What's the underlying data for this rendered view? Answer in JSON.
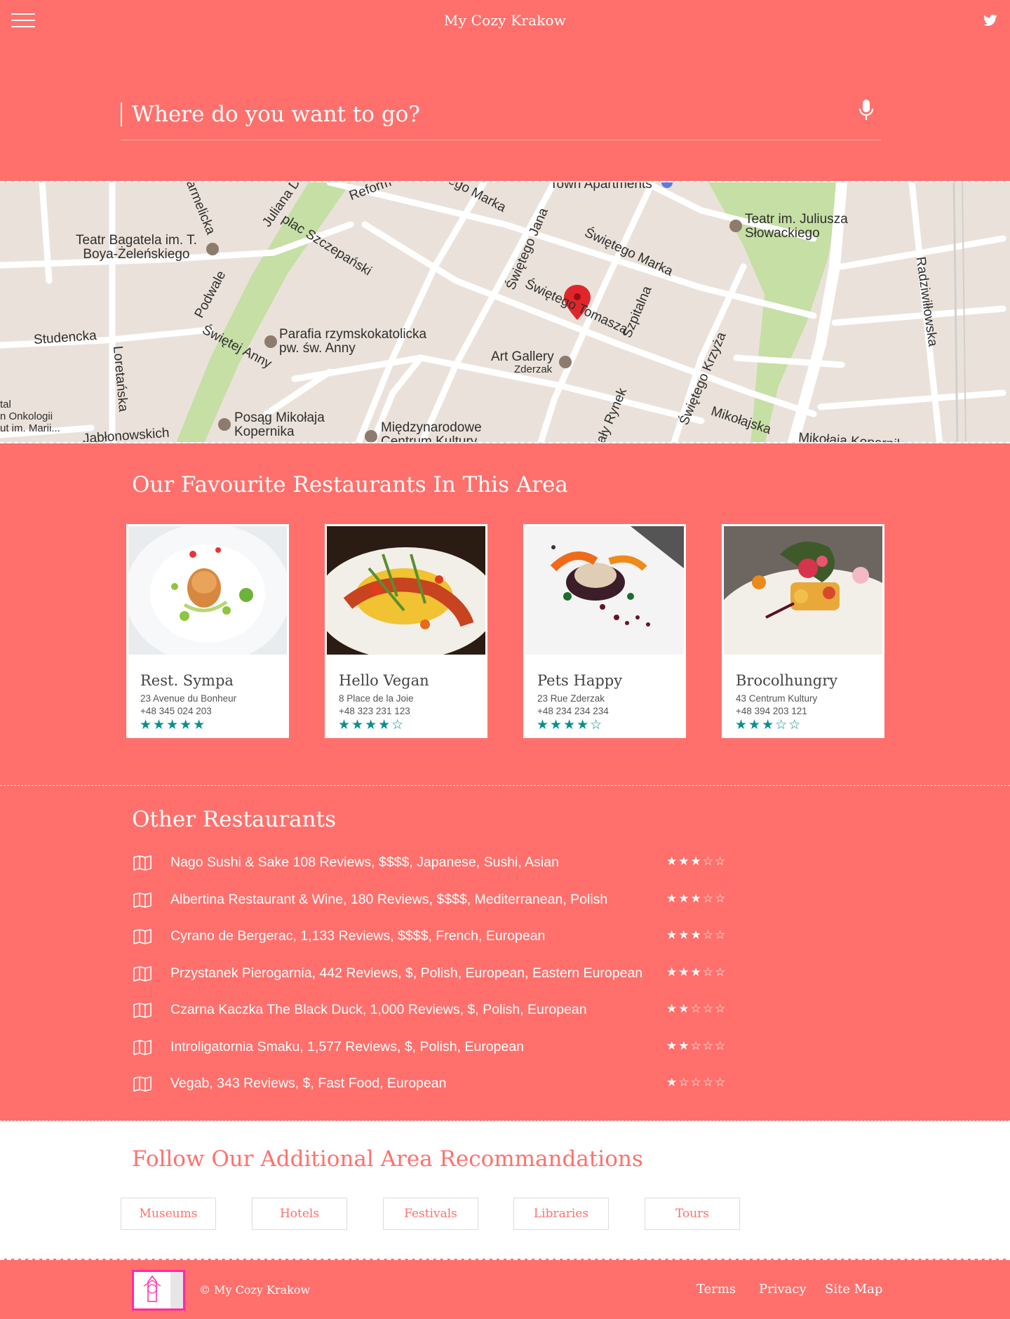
{
  "header": {
    "title": "My Cozy Krakow",
    "menu_icon": "hamburger-icon",
    "social_icon": "twitter-icon"
  },
  "search": {
    "placeholder": "Where do you want to go?",
    "value": "",
    "mic_icon": "microphone-icon"
  },
  "map": {
    "labels": {
      "teatr_bagatela": "Teatr Bagatela im. T.\nBoya-Żeleńskiego",
      "teatr_slowackiego": "Teatr im. Juliusza\nSłowackiego",
      "parafia": "Parafia rzymskokatolicka\npw. św. Anny",
      "art_gallery": "Art Gallery",
      "zderzak": "Zderzak",
      "posag": "Posąg Mikołaja\nKopernika",
      "miedzynarodowe": "Międzynarodowe\nCentrum Kultury",
      "town_apartments": "Town Apartments",
      "onkologii": "tal\nn Onkologii\nut im. Marii...",
      "studencka": "Studencka",
      "loretanska": "Loretańska",
      "podwale": "Podwale",
      "swietej_anny": "Świętej Anny",
      "plac_szczepanski": "plac Szczepański",
      "swietego_jana": "Świętego Jana",
      "swietego_marka": "Świętego Marka",
      "swietego_marka_2": "ego Marka",
      "swietego_tomasza": "Świętego Tomasza",
      "szpitalna": "Szpitalna",
      "swietego_krzyza": "Świętego Krzyża",
      "mikolajska": "Mikołajska",
      "mikolaja_kopernika": "Mikołaja Kopernika",
      "radziwillowska": "Radziwiłłowska",
      "karmelicka": "Karmelicka",
      "juliana_dunajewskiego": "Juliana Du",
      "reform": "Reform",
      "jablonowskich": "Jabłonowskich",
      "maly_rynek": "Mały Rynek"
    },
    "marker_icon": "location-pin-icon"
  },
  "favourites": {
    "title": "Our Favourite Restaurants In This Area",
    "cards": [
      {
        "name": "Rest. Sympa",
        "address": "23 Avenue du Bonheur",
        "phone": "+48 345 024 203",
        "rating": 5,
        "stars": "★★★★★"
      },
      {
        "name": "Hello Vegan",
        "address": "8 Place de la Joie",
        "phone": "+48 323 231 123",
        "rating": 4,
        "stars": "★★★★☆"
      },
      {
        "name": "Pets Happy",
        "address": "23 Rue Zderzak",
        "phone": "+48 234 234 234",
        "rating": 4,
        "stars": "★★★★☆"
      },
      {
        "name": "Brocolhungry",
        "address": "43 Centrum Kultury",
        "phone": "+48 394 203 121",
        "rating": 3,
        "stars": "★★★☆☆"
      }
    ]
  },
  "others": {
    "title": "Other Restaurants",
    "icon": "book-map-icon",
    "items": [
      {
        "label": "Nago Sushi & Sake 108 Reviews, $$$$, Japanese, Sushi, Asian",
        "rating": 3,
        "stars": "★★★☆☆"
      },
      {
        "label": "Albertina Restaurant & Wine, 180 Reviews, $$$$, Mediterranean, Polish",
        "rating": 3,
        "stars": "★★★☆☆"
      },
      {
        "label": "Cyrano de Bergerac, 1,133 Reviews, $$$$, French, European",
        "rating": 3,
        "stars": "★★★☆☆"
      },
      {
        "label": "Przystanek Pierogarnia, 442 Reviews, $, Polish, European, Eastern European",
        "rating": 3,
        "stars": "★★★☆☆"
      },
      {
        "label": "Czarna Kaczka The Black Duck, 1,000 Reviews, $, Polish, European",
        "rating": 2,
        "stars": "★★☆☆☆"
      },
      {
        "label": "Introligatornia Smaku, 1,577 Reviews, $, Polish, European",
        "rating": 2,
        "stars": "★★☆☆☆"
      },
      {
        "label": "Vegab, 343 Reviews, $, Fast Food, European",
        "rating": 1,
        "stars": "★☆☆☆☆"
      }
    ]
  },
  "recommendations": {
    "title": "Follow Our Additional Area Recommandations",
    "buttons": [
      "Museums",
      "Hotels",
      "Festivals",
      "Libraries",
      "Tours"
    ]
  },
  "footer": {
    "copyright": "© My Cozy Krakow",
    "links": [
      "Terms",
      "Privacy",
      "Site Map"
    ]
  },
  "colors": {
    "background": "#ff706c",
    "star_teal": "#0b8e8e",
    "logo_border": "#ff2aa5",
    "white": "#ffffff"
  }
}
